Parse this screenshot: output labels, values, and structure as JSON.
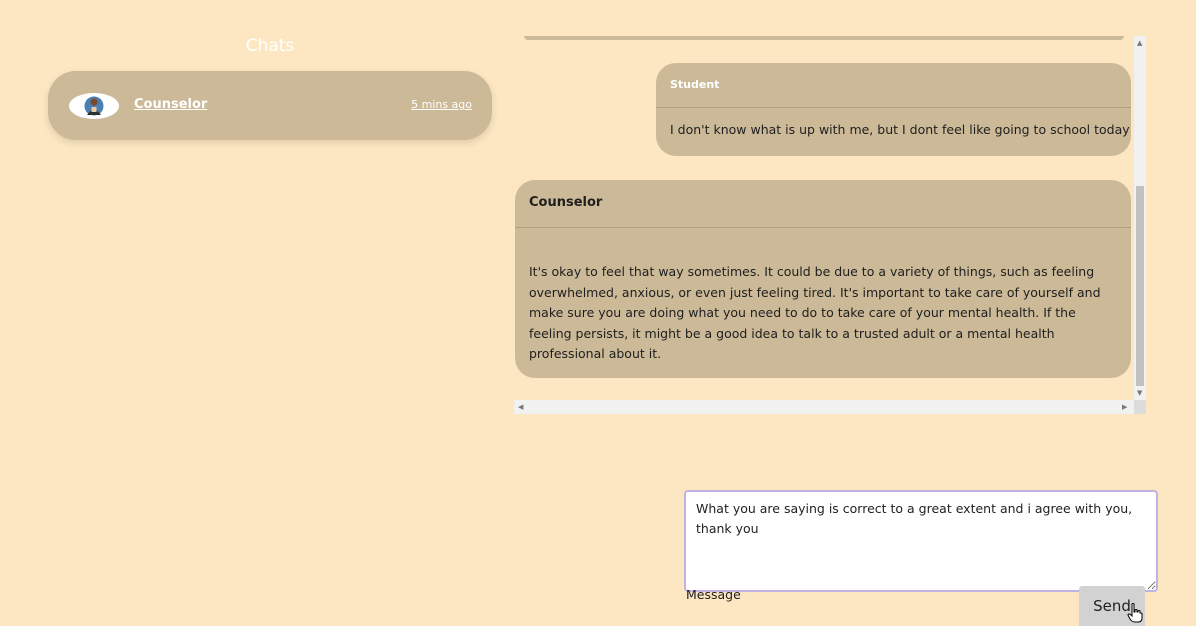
{
  "sidebar": {
    "title": "Chats",
    "chats": [
      {
        "name": "Counselor",
        "time": "5 mins ago",
        "avatar_icon": "counselor-avatar-icon"
      }
    ]
  },
  "messages": [
    {
      "sender": "Student",
      "text": "I don't know what is up with me, but I dont feel like going to school today"
    },
    {
      "sender": "Counselor",
      "text": "It's okay to feel that way sometimes. It could be due to a variety of things, such as feeling overwhelmed, anxious, or even just feeling tired. It's important to take care of yourself and make sure you are doing what you need to do to take care of your mental health. If the feeling persists, it might be a good idea to talk to a trusted adult or a mental health professional about it."
    }
  ],
  "composer": {
    "value": "What you are saying is correct to a great extent and i agree with you, thank you",
    "label": "Message",
    "send_label": "Send"
  },
  "colors": {
    "background": "#fde7c2",
    "bubble": "#cbb997",
    "input_focus_border": "#c2b2e4"
  }
}
